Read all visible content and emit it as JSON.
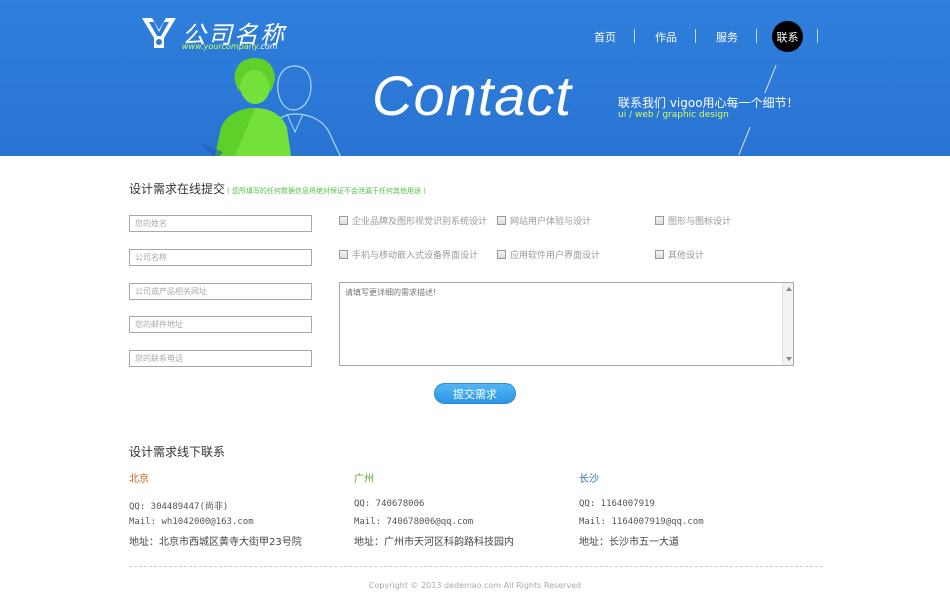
{
  "header": {
    "logo_text": "公司名称",
    "logo_url_main": "www.yourcompany",
    "logo_url_tail": ".com",
    "nav": [
      {
        "label": "首页"
      },
      {
        "label": "作品"
      },
      {
        "label": "服务"
      },
      {
        "label": "联系",
        "active": true
      }
    ],
    "big_title": "Contact",
    "slogan": "联系我们 vigoo用心每一个细节！",
    "slogan_sub": "ui / web / graphic design"
  },
  "form": {
    "title": "设计需求在线提交",
    "hint": "( 您所填写的任何数据信息将绝对保证不会泄漏于任何其他用途 )",
    "fields": [
      {
        "placeholder": "您的姓名"
      },
      {
        "placeholder": "公司名称"
      },
      {
        "placeholder": "公司或产品相关网址"
      },
      {
        "placeholder": "您的邮件地址"
      },
      {
        "placeholder": "您的联系电话"
      }
    ],
    "options": [
      {
        "label": "企业品牌及图形视觉识别系统设计"
      },
      {
        "label": "网站用户体验与设计"
      },
      {
        "label": "图形与图标设计"
      },
      {
        "label": "手机与移动嵌入式设备界面设计"
      },
      {
        "label": "应用软件用户界面设计"
      },
      {
        "label": "其他设计"
      }
    ],
    "textarea_placeholder": "请填写更详细的需求描述!",
    "submit_label": "提交需求"
  },
  "offline": {
    "title": "设计需求线下联系",
    "cities": [
      {
        "name": "北京",
        "color": "#c8601d",
        "qq": "QQ: 304489447(尚非)",
        "mail": "Mail: wh1042000@163.com",
        "address": "地址：北京市西城区黄寺大街甲23号院"
      },
      {
        "name": "广州",
        "color": "#5aa832",
        "qq": "QQ: 740678006",
        "mail": "Mail: 740678006@qq.com",
        "address": "地址：广州市天河区科韵路科技园内"
      },
      {
        "name": "长沙",
        "color": "#2b6fb8",
        "qq": "QQ: 1164007919",
        "mail": "Mail: 1164007919@qq.com",
        "address": "地址：长沙市五一大道"
      }
    ]
  },
  "footer": {
    "copyright": "Copyright © 2013 dedemao.com All Rights Reserved"
  },
  "colors": {
    "banner_blue": "#2b78d6",
    "accent_green": "#d6ff5a",
    "button_blue": "#2b96e6"
  }
}
